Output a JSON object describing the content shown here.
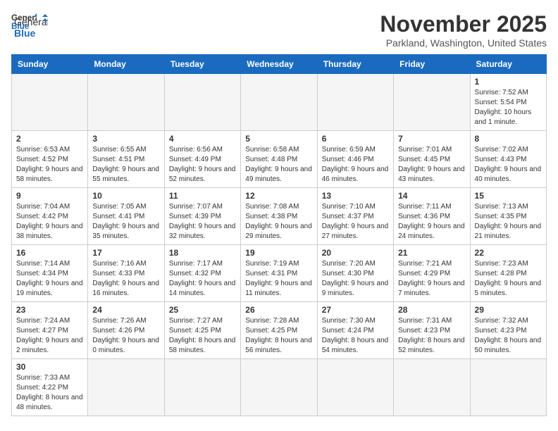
{
  "header": {
    "logo_general": "General",
    "logo_blue": "Blue",
    "month_title": "November 2025",
    "location": "Parkland, Washington, United States"
  },
  "weekdays": [
    "Sunday",
    "Monday",
    "Tuesday",
    "Wednesday",
    "Thursday",
    "Friday",
    "Saturday"
  ],
  "weeks": [
    [
      {
        "day": "",
        "info": ""
      },
      {
        "day": "",
        "info": ""
      },
      {
        "day": "",
        "info": ""
      },
      {
        "day": "",
        "info": ""
      },
      {
        "day": "",
        "info": ""
      },
      {
        "day": "",
        "info": ""
      },
      {
        "day": "1",
        "info": "Sunrise: 7:52 AM\nSunset: 5:54 PM\nDaylight: 10 hours and 1 minute."
      }
    ],
    [
      {
        "day": "2",
        "info": "Sunrise: 6:53 AM\nSunset: 4:52 PM\nDaylight: 9 hours and 58 minutes."
      },
      {
        "day": "3",
        "info": "Sunrise: 6:55 AM\nSunset: 4:51 PM\nDaylight: 9 hours and 55 minutes."
      },
      {
        "day": "4",
        "info": "Sunrise: 6:56 AM\nSunset: 4:49 PM\nDaylight: 9 hours and 52 minutes."
      },
      {
        "day": "5",
        "info": "Sunrise: 6:58 AM\nSunset: 4:48 PM\nDaylight: 9 hours and 49 minutes."
      },
      {
        "day": "6",
        "info": "Sunrise: 6:59 AM\nSunset: 4:46 PM\nDaylight: 9 hours and 46 minutes."
      },
      {
        "day": "7",
        "info": "Sunrise: 7:01 AM\nSunset: 4:45 PM\nDaylight: 9 hours and 43 minutes."
      },
      {
        "day": "8",
        "info": "Sunrise: 7:02 AM\nSunset: 4:43 PM\nDaylight: 9 hours and 40 minutes."
      }
    ],
    [
      {
        "day": "9",
        "info": "Sunrise: 7:04 AM\nSunset: 4:42 PM\nDaylight: 9 hours and 38 minutes."
      },
      {
        "day": "10",
        "info": "Sunrise: 7:05 AM\nSunset: 4:41 PM\nDaylight: 9 hours and 35 minutes."
      },
      {
        "day": "11",
        "info": "Sunrise: 7:07 AM\nSunset: 4:39 PM\nDaylight: 9 hours and 32 minutes."
      },
      {
        "day": "12",
        "info": "Sunrise: 7:08 AM\nSunset: 4:38 PM\nDaylight: 9 hours and 29 minutes."
      },
      {
        "day": "13",
        "info": "Sunrise: 7:10 AM\nSunset: 4:37 PM\nDaylight: 9 hours and 27 minutes."
      },
      {
        "day": "14",
        "info": "Sunrise: 7:11 AM\nSunset: 4:36 PM\nDaylight: 9 hours and 24 minutes."
      },
      {
        "day": "15",
        "info": "Sunrise: 7:13 AM\nSunset: 4:35 PM\nDaylight: 9 hours and 21 minutes."
      }
    ],
    [
      {
        "day": "16",
        "info": "Sunrise: 7:14 AM\nSunset: 4:34 PM\nDaylight: 9 hours and 19 minutes."
      },
      {
        "day": "17",
        "info": "Sunrise: 7:16 AM\nSunset: 4:33 PM\nDaylight: 9 hours and 16 minutes."
      },
      {
        "day": "18",
        "info": "Sunrise: 7:17 AM\nSunset: 4:32 PM\nDaylight: 9 hours and 14 minutes."
      },
      {
        "day": "19",
        "info": "Sunrise: 7:19 AM\nSunset: 4:31 PM\nDaylight: 9 hours and 11 minutes."
      },
      {
        "day": "20",
        "info": "Sunrise: 7:20 AM\nSunset: 4:30 PM\nDaylight: 9 hours and 9 minutes."
      },
      {
        "day": "21",
        "info": "Sunrise: 7:21 AM\nSunset: 4:29 PM\nDaylight: 9 hours and 7 minutes."
      },
      {
        "day": "22",
        "info": "Sunrise: 7:23 AM\nSunset: 4:28 PM\nDaylight: 9 hours and 5 minutes."
      }
    ],
    [
      {
        "day": "23",
        "info": "Sunrise: 7:24 AM\nSunset: 4:27 PM\nDaylight: 9 hours and 2 minutes."
      },
      {
        "day": "24",
        "info": "Sunrise: 7:26 AM\nSunset: 4:26 PM\nDaylight: 9 hours and 0 minutes."
      },
      {
        "day": "25",
        "info": "Sunrise: 7:27 AM\nSunset: 4:25 PM\nDaylight: 8 hours and 58 minutes."
      },
      {
        "day": "26",
        "info": "Sunrise: 7:28 AM\nSunset: 4:25 PM\nDaylight: 8 hours and 56 minutes."
      },
      {
        "day": "27",
        "info": "Sunrise: 7:30 AM\nSunset: 4:24 PM\nDaylight: 8 hours and 54 minutes."
      },
      {
        "day": "28",
        "info": "Sunrise: 7:31 AM\nSunset: 4:23 PM\nDaylight: 8 hours and 52 minutes."
      },
      {
        "day": "29",
        "info": "Sunrise: 7:32 AM\nSunset: 4:23 PM\nDaylight: 8 hours and 50 minutes."
      }
    ],
    [
      {
        "day": "30",
        "info": "Sunrise: 7:33 AM\nSunset: 4:22 PM\nDaylight: 8 hours and 48 minutes."
      },
      {
        "day": "",
        "info": ""
      },
      {
        "day": "",
        "info": ""
      },
      {
        "day": "",
        "info": ""
      },
      {
        "day": "",
        "info": ""
      },
      {
        "day": "",
        "info": ""
      },
      {
        "day": "",
        "info": ""
      }
    ]
  ]
}
